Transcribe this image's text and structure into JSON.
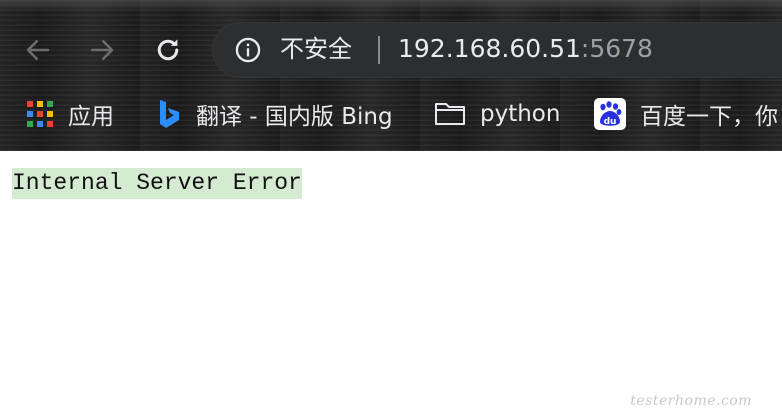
{
  "toolbar": {
    "back_icon": "arrow-left-icon",
    "forward_icon": "arrow-right-icon",
    "reload_icon": "reload-icon"
  },
  "omnibox": {
    "security_icon": "info-icon",
    "security_label": "不安全",
    "url_host": "192.168.60.51",
    "url_port": ":5678"
  },
  "bookmarks": {
    "items": [
      {
        "label": "应用",
        "icon": "apps-grid-icon"
      },
      {
        "label": "翻译 - 国内版 Bing",
        "icon": "bing-icon"
      },
      {
        "label": "python",
        "icon": "folder-icon"
      },
      {
        "label": "百度一下，你",
        "icon": "baidu-icon"
      }
    ]
  },
  "page": {
    "error_message": "Internal Server Error"
  },
  "watermark": "testerhome.com",
  "colors": {
    "frame": "#1b1b1b",
    "omnibox": "#2d2e30",
    "highlight": "#d4ead1",
    "bing": "#2d8cff",
    "baidu": "#2932e1"
  }
}
